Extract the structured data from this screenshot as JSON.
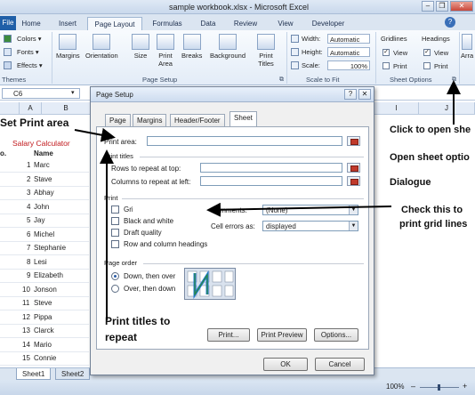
{
  "window": {
    "title": "sample workbook.xlsx - Microsoft Excel",
    "minimize": "–",
    "restore": "❐",
    "close": "✕"
  },
  "ribbon": {
    "tabs": [
      "File",
      "Home",
      "Insert",
      "Page Layout",
      "Formulas",
      "Data",
      "Review",
      "View",
      "Developer"
    ],
    "active_tab": "Page Layout",
    "themes": {
      "colors": "Colors ▾",
      "fonts": "Fonts ▾",
      "effects": "Effects ▾",
      "label": "Themes"
    },
    "page_setup": {
      "margins": "Margins",
      "orientation": "Orientation",
      "size": "Size",
      "print_area": "Print Area",
      "breaks": "Breaks",
      "background": "Background",
      "print_titles": "Print Titles",
      "label": "Page Setup"
    },
    "scale_to_fit": {
      "width_label": "Width:",
      "width_value": "Automatic",
      "height_label": "Height:",
      "height_value": "Automatic",
      "scale_label": "Scale:",
      "scale_value": "100%",
      "label": "Scale to Fit"
    },
    "sheet_options": {
      "gridlines": "Gridlines",
      "headings": "Headings",
      "view": "View",
      "print": "Print",
      "label": "Sheet Options"
    },
    "arrange": "Arra"
  },
  "formula_bar": {
    "name_box": "C6"
  },
  "grid": {
    "columns": [
      "A",
      "B",
      "I",
      "J"
    ],
    "title_cell": "Salary Calculator",
    "header_a": "o.",
    "header_b": "Name",
    "rows": [
      {
        "no": "1",
        "name": "Marc"
      },
      {
        "no": "2",
        "name": "Stave"
      },
      {
        "no": "3",
        "name": "Abhay"
      },
      {
        "no": "4",
        "name": "John"
      },
      {
        "no": "5",
        "name": "Jay"
      },
      {
        "no": "6",
        "name": "Michel"
      },
      {
        "no": "7",
        "name": "Stephanie"
      },
      {
        "no": "8",
        "name": "Lesi"
      },
      {
        "no": "9",
        "name": "Elizabeth"
      },
      {
        "no": "10",
        "name": "Jonson"
      },
      {
        "no": "11",
        "name": "Steve"
      },
      {
        "no": "12",
        "name": "Pippa"
      },
      {
        "no": "13",
        "name": "Clarck"
      },
      {
        "no": "14",
        "name": "Mario"
      },
      {
        "no": "15",
        "name": "Connie"
      }
    ]
  },
  "sheet_tabs": [
    "Sheet1",
    "Sheet2"
  ],
  "status": {
    "zoom": "100%",
    "zoom_out": "–",
    "zoom_in": "+"
  },
  "dialog": {
    "title": "Page Setup",
    "help": "?",
    "close": "✕",
    "tabs": [
      "Page",
      "Margins",
      "Header/Footer",
      "Sheet"
    ],
    "active_tab": "Sheet",
    "print_area_label": "Print area:",
    "print_titles_label": "Print titles",
    "rows_repeat_label": "Rows to repeat at top:",
    "cols_repeat_label": "Columns to repeat at left:",
    "print_label": "Print",
    "gridlines": "Gridlines",
    "black_white": "Black and white",
    "draft_quality": "Draft quality",
    "row_col_headings": "Row and column headings",
    "comments_label": "Comments:",
    "comments_value": "(None)",
    "cell_errors_label": "Cell errors as:",
    "cell_errors_value": "displayed",
    "page_order_label": "Page order",
    "down_then_over": "Down, then over",
    "over_then_down": "Over, then down",
    "print_btn": "Print...",
    "print_preview_btn": "Print Preview",
    "options_btn": "Options...",
    "ok_btn": "OK",
    "cancel_btn": "Cancel"
  },
  "annotations": {
    "set_print_area": "Set Print area",
    "click_open": "Click to open she",
    "open_sheet_opts": "Open sheet optio",
    "dialogue": "Dialogue",
    "check_this": "Check this to",
    "print_grid": "print grid lines",
    "print_titles_1": "Print titles to",
    "print_titles_2": "repeat"
  }
}
